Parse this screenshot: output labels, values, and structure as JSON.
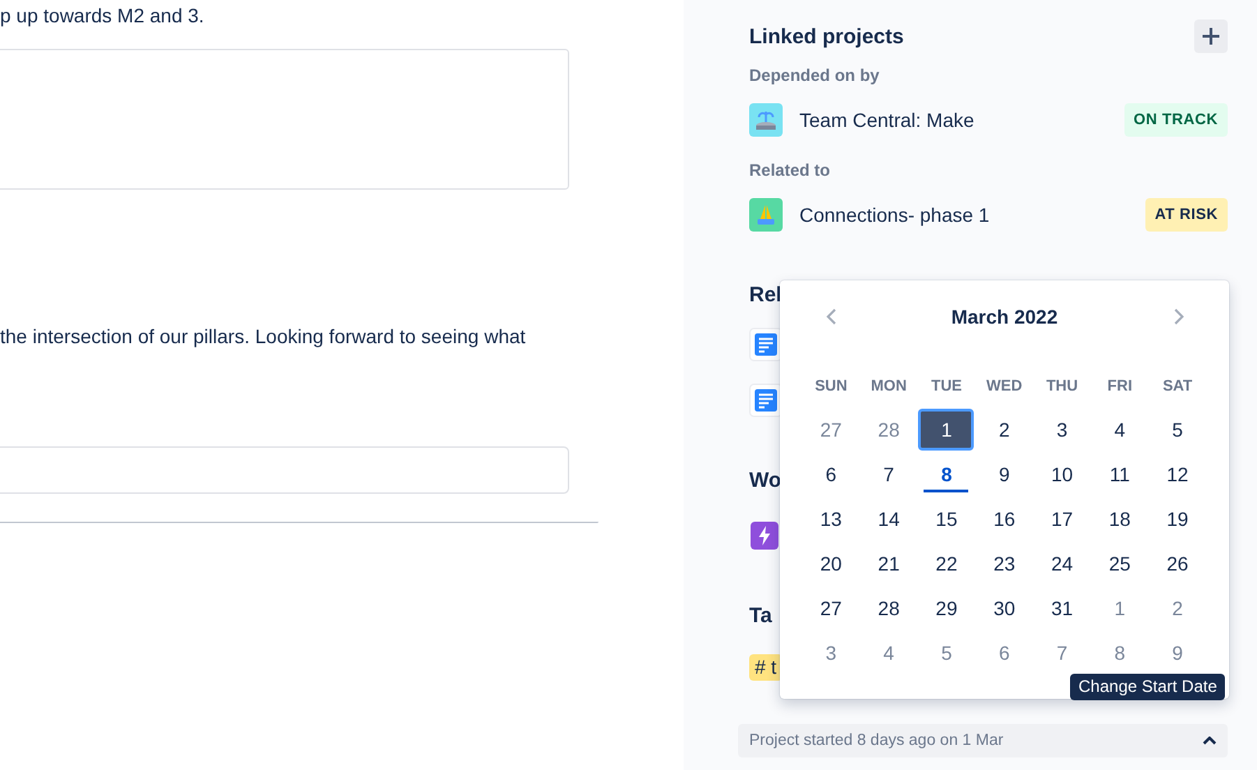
{
  "main": {
    "text_1": "p up towards M2 and 3.",
    "text_2": "the intersection of our pillars. Looking forward to seeing what"
  },
  "sidebar": {
    "linked_projects": {
      "title": "Linked projects",
      "groups": [
        {
          "label": "Depended on by",
          "projects": [
            {
              "name": "Team Central: Make",
              "status": "ON TRACK",
              "kind": "on_track"
            }
          ]
        },
        {
          "label": "Related to",
          "projects": [
            {
              "name": "Connections- phase 1",
              "status": "AT RISK",
              "kind": "at_risk"
            }
          ]
        }
      ]
    },
    "sections": [
      {
        "title": "Rel",
        "items": [
          {
            "kind": "doc"
          },
          {
            "kind": "doc"
          }
        ]
      },
      {
        "title": "Wo",
        "items": [
          {
            "kind": "bolt"
          }
        ]
      },
      {
        "title": "Ta",
        "items": [
          {
            "kind": "tag",
            "label": "# t"
          }
        ]
      }
    ],
    "footer": "Project started 8 days ago on 1 Mar"
  },
  "calendar": {
    "title": "March 2022",
    "weekdays": [
      "SUN",
      "MON",
      "TUE",
      "WED",
      "THU",
      "FRI",
      "SAT"
    ],
    "weeks": [
      [
        {
          "day": "27",
          "outside": true,
          "selected": false,
          "today": false
        },
        {
          "day": "28",
          "outside": true,
          "selected": false,
          "today": false
        },
        {
          "day": "1",
          "outside": false,
          "selected": true,
          "today": false
        },
        {
          "day": "2",
          "outside": false,
          "selected": false,
          "today": false
        },
        {
          "day": "3",
          "outside": false,
          "selected": false,
          "today": false
        },
        {
          "day": "4",
          "outside": false,
          "selected": false,
          "today": false
        },
        {
          "day": "5",
          "outside": false,
          "selected": false,
          "today": false
        }
      ],
      [
        {
          "day": "6",
          "outside": false,
          "selected": false,
          "today": false
        },
        {
          "day": "7",
          "outside": false,
          "selected": false,
          "today": false
        },
        {
          "day": "8",
          "outside": false,
          "selected": false,
          "today": true
        },
        {
          "day": "9",
          "outside": false,
          "selected": false,
          "today": false
        },
        {
          "day": "10",
          "outside": false,
          "selected": false,
          "today": false
        },
        {
          "day": "11",
          "outside": false,
          "selected": false,
          "today": false
        },
        {
          "day": "12",
          "outside": false,
          "selected": false,
          "today": false
        }
      ],
      [
        {
          "day": "13",
          "outside": false,
          "selected": false,
          "today": false
        },
        {
          "day": "14",
          "outside": false,
          "selected": false,
          "today": false
        },
        {
          "day": "15",
          "outside": false,
          "selected": false,
          "today": false
        },
        {
          "day": "16",
          "outside": false,
          "selected": false,
          "today": false
        },
        {
          "day": "17",
          "outside": false,
          "selected": false,
          "today": false
        },
        {
          "day": "18",
          "outside": false,
          "selected": false,
          "today": false
        },
        {
          "day": "19",
          "outside": false,
          "selected": false,
          "today": false
        }
      ],
      [
        {
          "day": "20",
          "outside": false,
          "selected": false,
          "today": false
        },
        {
          "day": "21",
          "outside": false,
          "selected": false,
          "today": false
        },
        {
          "day": "22",
          "outside": false,
          "selected": false,
          "today": false
        },
        {
          "day": "23",
          "outside": false,
          "selected": false,
          "today": false
        },
        {
          "day": "24",
          "outside": false,
          "selected": false,
          "today": false
        },
        {
          "day": "25",
          "outside": false,
          "selected": false,
          "today": false
        },
        {
          "day": "26",
          "outside": false,
          "selected": false,
          "today": false
        }
      ],
      [
        {
          "day": "27",
          "outside": false,
          "selected": false,
          "today": false
        },
        {
          "day": "28",
          "outside": false,
          "selected": false,
          "today": false
        },
        {
          "day": "29",
          "outside": false,
          "selected": false,
          "today": false
        },
        {
          "day": "30",
          "outside": false,
          "selected": false,
          "today": false
        },
        {
          "day": "31",
          "outside": false,
          "selected": false,
          "today": false
        },
        {
          "day": "1",
          "outside": true,
          "selected": false,
          "today": false
        },
        {
          "day": "2",
          "outside": true,
          "selected": false,
          "today": false
        }
      ],
      [
        {
          "day": "3",
          "outside": true,
          "selected": false,
          "today": false
        },
        {
          "day": "4",
          "outside": true,
          "selected": false,
          "today": false
        },
        {
          "day": "5",
          "outside": true,
          "selected": false,
          "today": false
        },
        {
          "day": "6",
          "outside": true,
          "selected": false,
          "today": false
        },
        {
          "day": "7",
          "outside": true,
          "selected": false,
          "today": false
        },
        {
          "day": "8",
          "outside": true,
          "selected": false,
          "today": false
        },
        {
          "day": "9",
          "outside": true,
          "selected": false,
          "today": false
        }
      ]
    ]
  },
  "tooltip": "Change Start Date"
}
